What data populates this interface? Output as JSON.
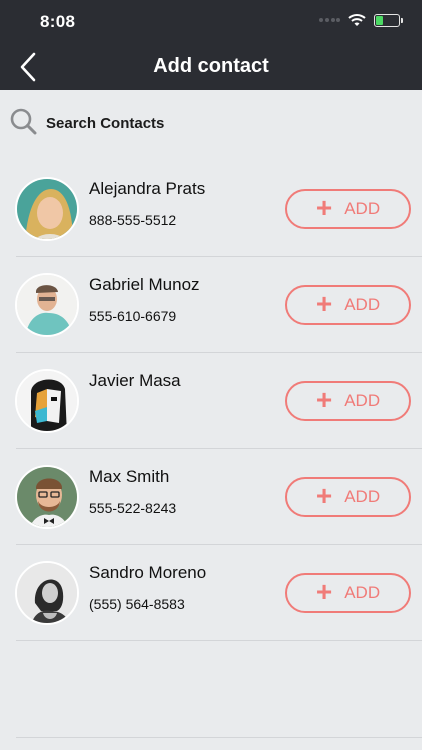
{
  "status_bar": {
    "time": "8:08"
  },
  "header": {
    "title": "Add contact"
  },
  "search": {
    "label": "Search Contacts"
  },
  "contacts": [
    {
      "name": "Alejandra Prats",
      "phone": "888-555-5512",
      "add_label": "ADD"
    },
    {
      "name": "Gabriel Munoz",
      "phone": "555-610-6679",
      "add_label": "ADD"
    },
    {
      "name": "Javier Masa",
      "phone": "",
      "add_label": "ADD"
    },
    {
      "name": "Max Smith",
      "phone": "555-522-8243",
      "add_label": "ADD"
    },
    {
      "name": "Sandro Moreno",
      "phone": "(555) 564-8583",
      "add_label": "ADD"
    }
  ],
  "colors": {
    "accent": "#f07b78",
    "header_bg": "#2b2d33",
    "background": "#e9ebed"
  },
  "icons": [
    "back-chevron-icon",
    "search-icon",
    "plus-icon",
    "wifi-icon",
    "battery-icon",
    "signal-icon"
  ]
}
